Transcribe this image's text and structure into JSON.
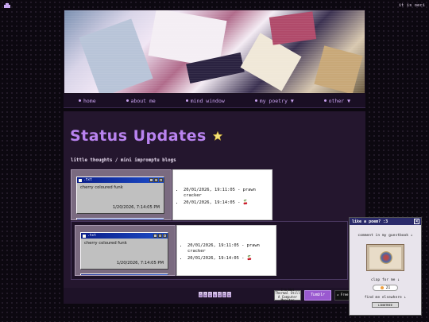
{
  "top_note": "it is oeci",
  "nav": {
    "items": [
      {
        "label": "home"
      },
      {
        "label": "about me"
      },
      {
        "label": "mind window"
      },
      {
        "label": "my poetry ▼"
      },
      {
        "label": "other ▼"
      }
    ]
  },
  "main": {
    "title": "Status Updates",
    "subtitle": "little thoughts / mini impromptu blogs"
  },
  "status_window": {
    "title_bar": ".txt",
    "message": "cherry coloured funk",
    "timestamp_top": "1/20/2026, 7:14:05 PM",
    "timestamp_bottom": "1/20/2026, 7:14:05 PM"
  },
  "log_top": {
    "entries": [
      "20/01/2026, 19:11:05 - prawn cracker",
      "20/01/2026, 19:14:05 - 🍒"
    ]
  },
  "log_bottom": {
    "entries": [
      "20/01/2026, 19:11:05 - prawn cracker",
      "20/01/2026, 19:14:05 - 🍒"
    ]
  },
  "footer": {
    "counter_digits": [
      "0",
      "0",
      "5",
      "4",
      "5",
      "5",
      "5"
    ],
    "badge_1": "I'm Not Thermal Still A Computer Monitor",
    "badge_2": "Tumblr",
    "badge_3": "★ Free"
  },
  "popup": {
    "title": "like a poem? :3",
    "comment_text": "comment in my guestbook ↓",
    "clap_text": "clap for me ↓",
    "clap_count": "21",
    "find_text": "find me elsewhere ↓",
    "find_button": "LINKTREE"
  },
  "colors": {
    "accent": "#b983f0",
    "background": "#0c0810",
    "panel": "#24162e"
  }
}
